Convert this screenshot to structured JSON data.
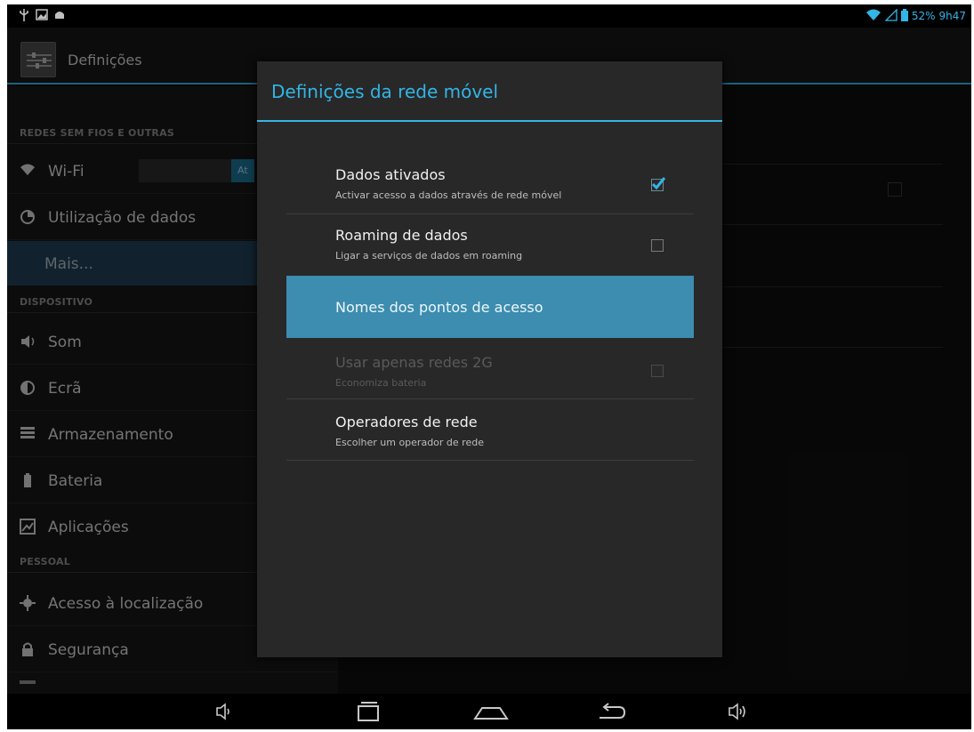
{
  "status_bar": {
    "left_icons": [
      "usb-icon",
      "image-notification-icon",
      "android-debug-icon"
    ],
    "battery": "52%",
    "time": "9h47"
  },
  "action_bar": {
    "title": "Definições"
  },
  "settings_list": {
    "sections": [
      {
        "header": "REDES SEM FIOS E OUTRAS",
        "items": [
          {
            "label": "Wi-Fi",
            "icon": "wifi-icon",
            "toggle": "Ativado"
          },
          {
            "label": "Utilização de dados",
            "icon": "data-usage-icon"
          },
          {
            "label": "Mais...",
            "selected": true
          }
        ]
      },
      {
        "header": "DISPOSITIVO",
        "items": [
          {
            "label": "Som",
            "icon": "speaker-icon"
          },
          {
            "label": "Ecrã",
            "icon": "brightness-icon"
          },
          {
            "label": "Armazenamento",
            "icon": "storage-icon"
          },
          {
            "label": "Bateria",
            "icon": "battery-icon"
          },
          {
            "label": "Aplicações",
            "icon": "apps-icon"
          }
        ]
      },
      {
        "header": "PESSOAL",
        "items": [
          {
            "label": "Acesso à localização",
            "icon": "location-icon"
          },
          {
            "label": "Segurança",
            "icon": "lock-icon"
          }
        ]
      }
    ]
  },
  "dialog": {
    "title": "Definições da rede móvel",
    "items": [
      {
        "title": "Dados ativados",
        "summary": "Activar acesso a dados através de rede móvel",
        "checked": true,
        "enabled": true
      },
      {
        "title": "Roaming de dados",
        "summary": "Ligar a serviços de dados em roaming",
        "checked": false,
        "enabled": true
      },
      {
        "title": "Nomes dos pontos de acesso",
        "summary": "",
        "highlighted": true,
        "enabled": true
      },
      {
        "title": "Usar apenas redes 2G",
        "summary": "Economiza bateria",
        "checked": false,
        "enabled": false
      },
      {
        "title": "Operadores de rede",
        "summary": "Escolher um operador de rede",
        "enabled": true
      }
    ]
  },
  "nav_bar": {
    "buttons": [
      "volume-down-icon",
      "recent-apps-icon",
      "home-icon",
      "back-icon",
      "volume-up-icon"
    ]
  },
  "colors": {
    "accent": "#33b5e5",
    "highlight": "#3c8daf",
    "dialog_bg": "#282828",
    "panel_bg": "#161616"
  }
}
